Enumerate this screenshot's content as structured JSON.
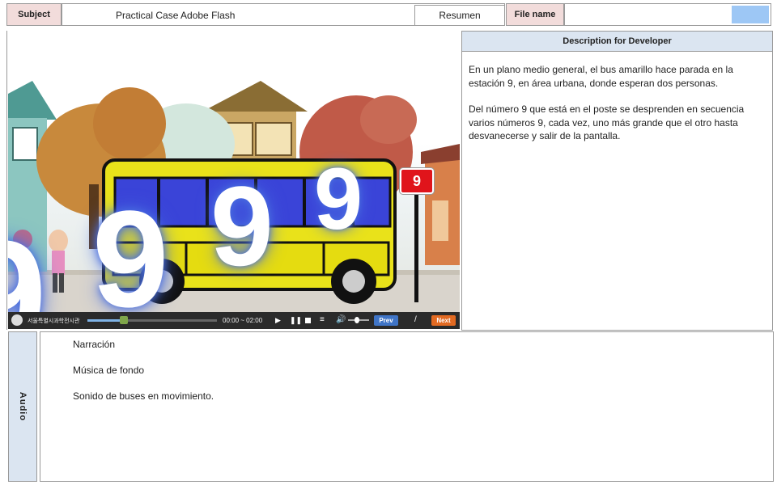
{
  "header": {
    "subject_label": "Subject",
    "subject_value": "Practical Case Adobe Flash",
    "resumen_label": "Resumen",
    "filename_label": "File name",
    "filename_value": ""
  },
  "description": {
    "title": "Description for Developer",
    "paragraphs": [
      "En un plano medio general, el bus amarillo hace parada en la estación 9, en área urbana, donde esperan dos personas.",
      "Del número 9 que está en el poste se desprenden en secuencia varios números 9, cada vez, uno más grande que el otro hasta desvanecerse y salir de la pantalla."
    ]
  },
  "scene": {
    "bus_stop_sign": "9",
    "floating_numbers": [
      "9",
      "9",
      "9",
      "9"
    ]
  },
  "player": {
    "logo_text": "서울특별시과학전시관",
    "time": "00:00 ~ 02:00",
    "prev_label": "Prev",
    "page_sep": "/",
    "next_label": "Next",
    "progress": 0.28
  },
  "audio": {
    "side_label": "Audio",
    "items": [
      "Narración",
      "Música de fondo",
      "Sonido de buses en movimiento."
    ]
  }
}
